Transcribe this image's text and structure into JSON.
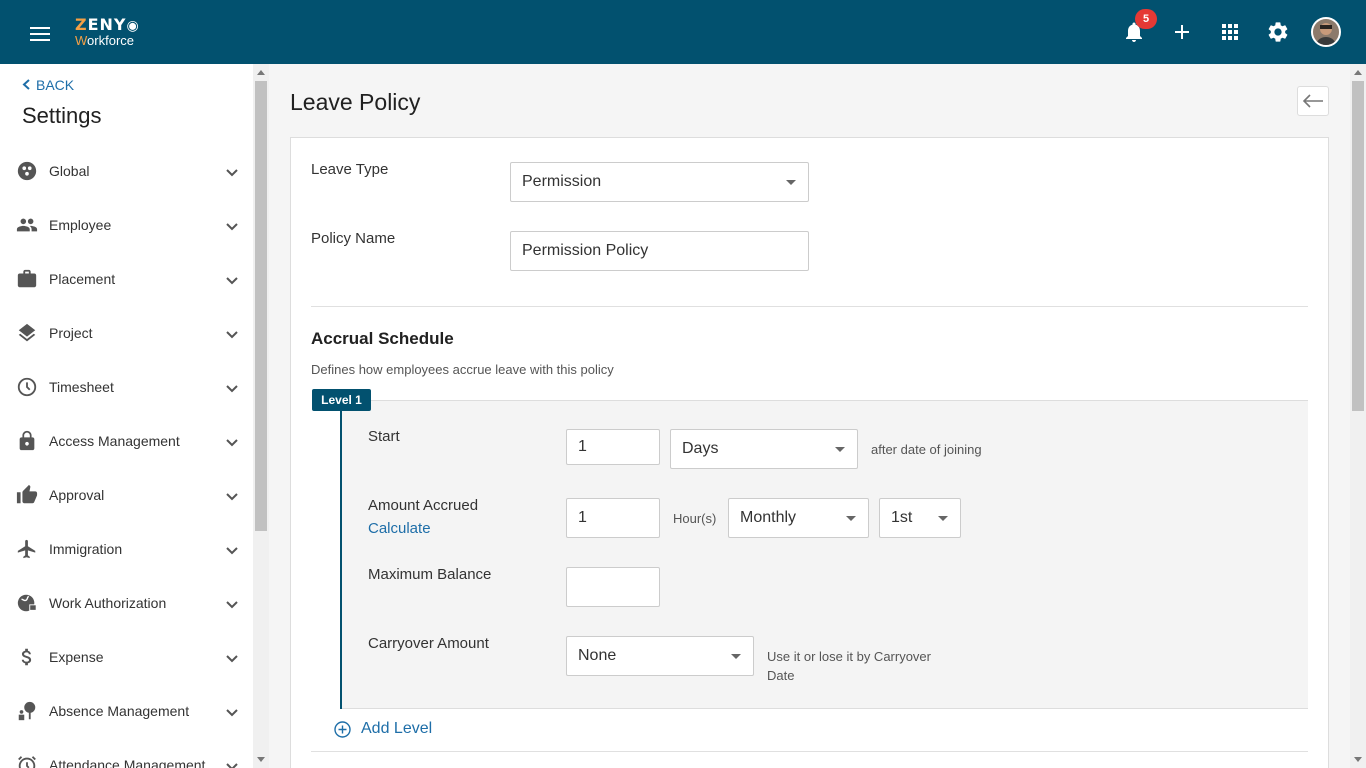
{
  "app": {
    "logo_top": "ZENY",
    "logo_top_first": "Z",
    "logo_bottom_first": "W",
    "logo_bottom_rest": "orkforce",
    "notification_count": "5"
  },
  "sidebar": {
    "back_label": "BACK",
    "title": "Settings",
    "items": [
      {
        "label": "Global",
        "icon": "globe-icon"
      },
      {
        "label": "Employee",
        "icon": "people-icon"
      },
      {
        "label": "Placement",
        "icon": "briefcase-icon"
      },
      {
        "label": "Project",
        "icon": "layers-icon"
      },
      {
        "label": "Timesheet",
        "icon": "clock-icon"
      },
      {
        "label": "Access Management",
        "icon": "lock-icon"
      },
      {
        "label": "Approval",
        "icon": "thumbs-up-icon"
      },
      {
        "label": "Immigration",
        "icon": "airplane-icon"
      },
      {
        "label": "Work Authorization",
        "icon": "globe-lock-icon"
      },
      {
        "label": "Expense",
        "icon": "dollar-icon"
      },
      {
        "label": "Absence Management",
        "icon": "person-tree-icon"
      },
      {
        "label": "Attendance Management",
        "icon": "alarm-clock-icon"
      }
    ]
  },
  "main": {
    "page_title": "Leave Policy",
    "leave_type": {
      "label": "Leave Type",
      "value": "Permission"
    },
    "policy_name": {
      "label": "Policy Name",
      "value": "Permission Policy"
    },
    "accrual": {
      "title": "Accrual Schedule",
      "description": "Defines how employees accrue leave with this policy",
      "level_tag": "Level 1",
      "start": {
        "label": "Start",
        "value": "1",
        "unit": "Days",
        "suffix": "after date of joining"
      },
      "amount": {
        "label": "Amount Accrued",
        "link": "Calculate",
        "value": "1",
        "unit": "Hour(s)",
        "frequency": "Monthly",
        "day": "1st"
      },
      "max_balance": {
        "label": "Maximum Balance",
        "value": ""
      },
      "carryover": {
        "label": "Carryover Amount",
        "value": "None",
        "note_line1": "Use it or lose it by Carryover",
        "note_line2": "Date"
      },
      "add_level": "Add Level"
    }
  },
  "colors": {
    "topbar": "#02516f",
    "link": "#1e6ea8",
    "badge": "#e53935",
    "logo_accent": "#f3a046"
  }
}
